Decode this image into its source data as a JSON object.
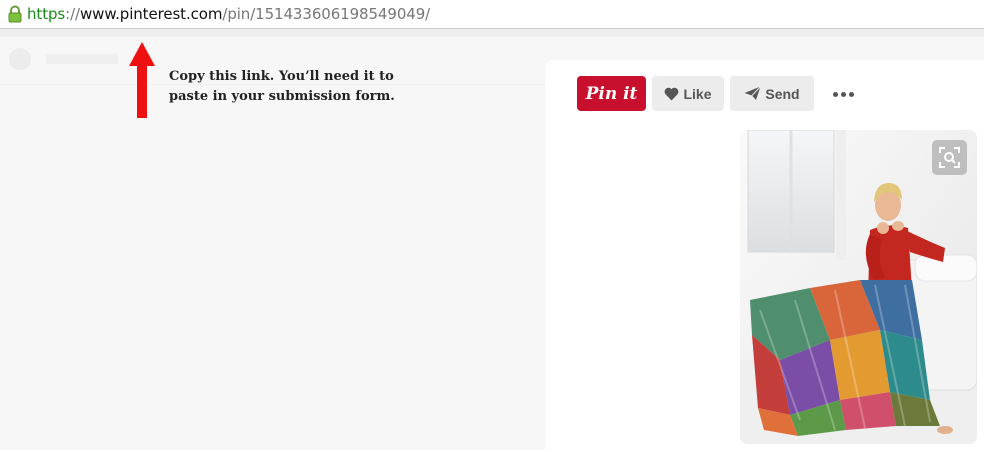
{
  "browser": {
    "url_scheme": "https",
    "url_separator": "://",
    "url_host": "www.pinterest.com",
    "url_path": "/pin/151433606198549049/",
    "lock_icon": "lock-icon",
    "colors": {
      "scheme": "#1a8b1a",
      "path": "#777777"
    }
  },
  "annotation": {
    "line1": "Copy this link. You’ll need it to",
    "line2": "paste in your submission form.",
    "arrow_color": "#ee1111"
  },
  "toolbar": {
    "pinit_label": "Pin it",
    "like_label": "Like",
    "send_label": "Send",
    "more_icon": "more-dots-icon",
    "brand_color": "#c8102e"
  },
  "pin": {
    "image_icon": "visual-search-icon"
  }
}
